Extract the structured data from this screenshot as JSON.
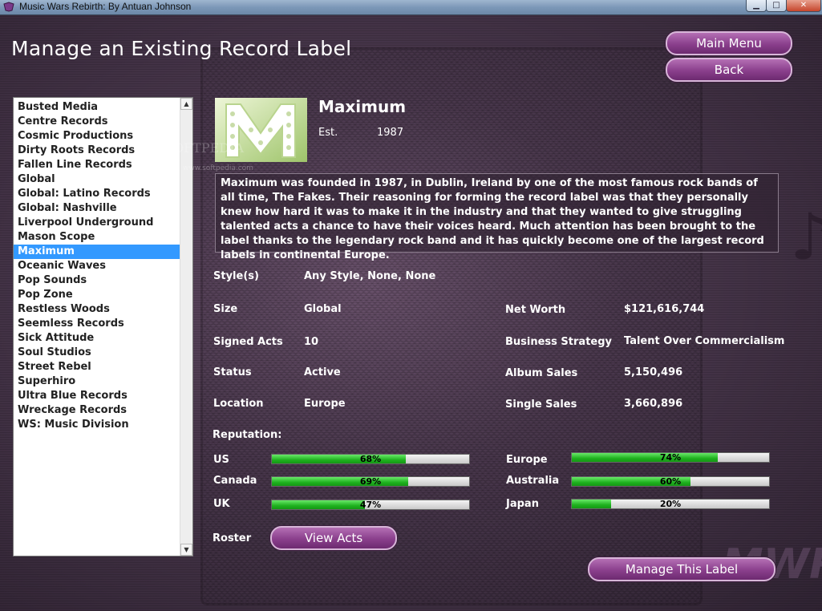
{
  "window": {
    "title": "Music Wars Rebirth: By Antuan Johnson",
    "min": "▁",
    "max": "□",
    "close": "✕"
  },
  "page_title": "Manage an Existing Record Label",
  "buttons": {
    "main_menu": "Main Menu",
    "back": "Back",
    "view_acts": "View Acts",
    "manage": "Manage This Label"
  },
  "labels": [
    "Busted Media",
    "Centre Records",
    "Cosmic Productions",
    "Dirty Roots Records",
    "Fallen Line Records",
    "Global",
    "Global: Latino Records",
    "Global: Nashville",
    "Liverpool Underground",
    "Mason Scope",
    "Maximum",
    "Oceanic Waves",
    "Pop Sounds",
    "Pop Zone",
    "Restless Woods",
    "Seemless Records",
    "Sick Attitude",
    "Soul Studios",
    "Street Rebel",
    "Superhiro",
    "Ultra Blue Records",
    "Wreckage Records",
    "WS: Music Division"
  ],
  "selected_label": "Maximum",
  "label": {
    "name": "Maximum",
    "est_label": "Est.",
    "est_year": "1987",
    "description": "Maximum was founded in 1987, in Dublin, Ireland by one of the most famous rock bands of all time, The Fakes. Their reasoning for forming the record label was that they personally knew how hard it was to make it in the industry and that they wanted to give struggling talented acts a chance to have their voices heard. Much attention has been brought to the label thanks to the legendary rock band and it has quickly become one of the largest record labels in continental Europe."
  },
  "watermark": {
    "main": "SOFTPEDIA",
    "url": "www.softpedia.com"
  },
  "fields": {
    "styles_label": "Style(s)",
    "styles": "Any Style, None, None",
    "size_label": "Size",
    "size": "Global",
    "signed_label": "Signed Acts",
    "signed": "10",
    "status_label": "Status",
    "status": "Active",
    "location_label": "Location",
    "location": "Europe",
    "networth_label": "Net Worth",
    "networth": "$121,616,744",
    "strategy_label": "Business Strategy",
    "strategy": "Talent Over Commercialism",
    "album_label": "Album Sales",
    "album": "5,150,496",
    "single_label": "Single Sales",
    "single": "3,660,896",
    "reputation_label": "Reputation:",
    "roster_label": "Roster"
  },
  "reputation": [
    {
      "region": "US",
      "value": 68,
      "pct": "68%"
    },
    {
      "region": "Canada",
      "value": 69,
      "pct": "69%"
    },
    {
      "region": "UK",
      "value": 47,
      "pct": "47%"
    },
    {
      "region": "Europe",
      "value": 74,
      "pct": "74%"
    },
    {
      "region": "Australia",
      "value": 60,
      "pct": "60%"
    },
    {
      "region": "Japan",
      "value": 20,
      "pct": "20%"
    }
  ],
  "brand_logo": "MWR",
  "colors": {
    "accent": "#8a3f8c",
    "selection": "#3399ff",
    "bar_fill": "#1fb21f"
  },
  "icons": {
    "scroll_up": "▲",
    "scroll_down": "▼"
  }
}
